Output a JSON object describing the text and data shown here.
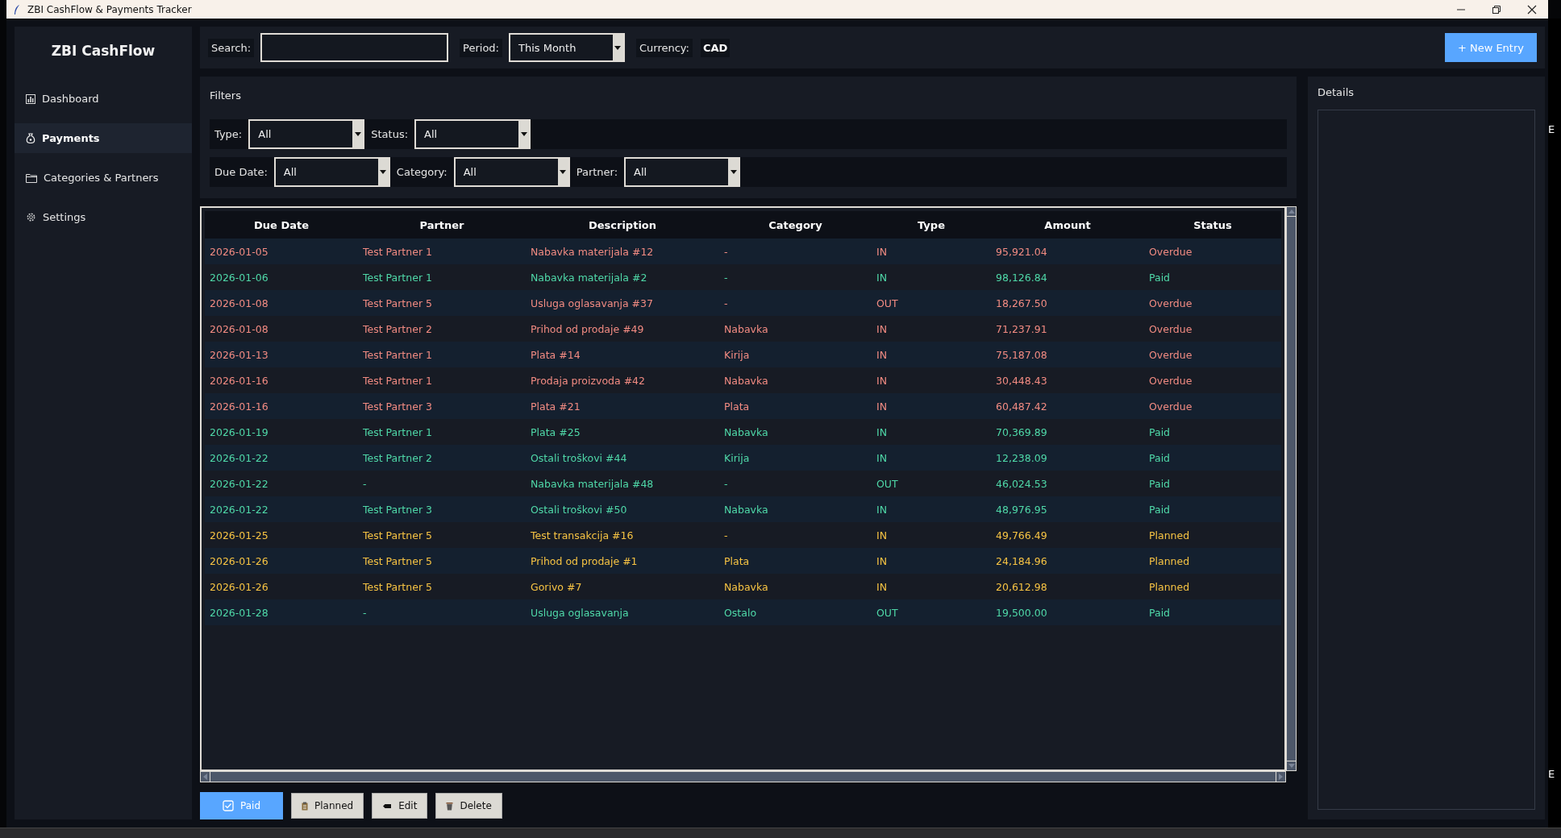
{
  "window": {
    "title": "ZBI CashFlow & Payments Tracker"
  },
  "sidebar": {
    "title": "ZBI CashFlow",
    "items": [
      {
        "label": "Dashboard",
        "selected": false
      },
      {
        "label": "Payments",
        "selected": true
      },
      {
        "label": "Categories & Partners",
        "selected": false
      },
      {
        "label": "Settings",
        "selected": false
      }
    ]
  },
  "toolbar": {
    "search": {
      "label": "Search:"
    },
    "period": {
      "label": "Period:",
      "value": "This Month"
    },
    "currency": {
      "label": "Currency:",
      "value": "CAD"
    },
    "new_button": "+ New Entry"
  },
  "filters": {
    "title": "Filters",
    "rows": [
      [
        {
          "label": "Type:",
          "value": "All"
        },
        {
          "label": "Status:",
          "value": "All"
        }
      ],
      [
        {
          "label": "Due Date:",
          "value": "All"
        },
        {
          "label": "Category:",
          "value": "All"
        },
        {
          "label": "Partner:",
          "value": "All"
        }
      ]
    ]
  },
  "table": {
    "columns": [
      "Due Date",
      "Partner",
      "Description",
      "Category",
      "Type",
      "Amount",
      "Status"
    ],
    "rows": [
      {
        "kind": "overdue",
        "cells": [
          "2026-01-05",
          "Test Partner 1",
          "Nabavka materijala #12",
          "-",
          "IN",
          "95,921.04",
          "Overdue"
        ]
      },
      {
        "kind": "paid",
        "cells": [
          "2026-01-06",
          "Test Partner 1",
          "Nabavka materijala #2",
          "-",
          "IN",
          "98,126.84",
          "Paid"
        ]
      },
      {
        "kind": "overdue",
        "cells": [
          "2026-01-08",
          "Test Partner 5",
          "Usluga oglasavanja #37",
          "-",
          "OUT",
          "18,267.50",
          "Overdue"
        ]
      },
      {
        "kind": "overdue",
        "cells": [
          "2026-01-08",
          "Test Partner 2",
          "Prihod od prodaje #49",
          "Nabavka",
          "IN",
          "71,237.91",
          "Overdue"
        ]
      },
      {
        "kind": "overdue",
        "cells": [
          "2026-01-13",
          "Test Partner 1",
          "Plata #14",
          "Kirija",
          "IN",
          "75,187.08",
          "Overdue"
        ]
      },
      {
        "kind": "overdue",
        "cells": [
          "2026-01-16",
          "Test Partner 1",
          "Prodaja proizvoda #42",
          "Nabavka",
          "IN",
          "30,448.43",
          "Overdue"
        ]
      },
      {
        "kind": "overdue",
        "cells": [
          "2026-01-16",
          "Test Partner 3",
          "Plata #21",
          "Plata",
          "IN",
          "60,487.42",
          "Overdue"
        ]
      },
      {
        "kind": "paid",
        "cells": [
          "2026-01-19",
          "Test Partner 1",
          "Plata #25",
          "Nabavka",
          "IN",
          "70,369.89",
          "Paid"
        ]
      },
      {
        "kind": "paid",
        "cells": [
          "2026-01-22",
          "Test Partner 2",
          "Ostali troškovi #44",
          "Kirija",
          "IN",
          "12,238.09",
          "Paid"
        ]
      },
      {
        "kind": "paid",
        "cells": [
          "2026-01-22",
          "-",
          "Nabavka materijala #48",
          "-",
          "OUT",
          "46,024.53",
          "Paid"
        ]
      },
      {
        "kind": "paid",
        "cells": [
          "2026-01-22",
          "Test Partner 3",
          "Ostali troškovi #50",
          "Nabavka",
          "IN",
          "48,976.95",
          "Paid"
        ]
      },
      {
        "kind": "planned",
        "cells": [
          "2026-01-25",
          "Test Partner 5",
          "Test transakcija #16",
          "-",
          "IN",
          "49,766.49",
          "Planned"
        ]
      },
      {
        "kind": "planned",
        "cells": [
          "2026-01-26",
          "Test Partner 5",
          "Prihod od prodaje #1",
          "Plata",
          "IN",
          "24,184.96",
          "Planned"
        ]
      },
      {
        "kind": "planned",
        "cells": [
          "2026-01-26",
          "Test Partner 5",
          "Gorivo #7",
          "Nabavka",
          "IN",
          "20,612.98",
          "Planned"
        ]
      },
      {
        "kind": "paid",
        "cells": [
          "2026-01-28",
          "-",
          "Usluga oglasavanja",
          "Ostalo",
          "OUT",
          "19,500.00",
          "Paid"
        ]
      }
    ]
  },
  "actions": [
    {
      "label": "Paid",
      "primary": true
    },
    {
      "label": "Planned",
      "primary": false
    },
    {
      "label": "Edit",
      "primary": false
    },
    {
      "label": "Delete",
      "primary": false
    }
  ],
  "details": {
    "title": "Details"
  },
  "edge_marks": [
    "E",
    "E"
  ]
}
